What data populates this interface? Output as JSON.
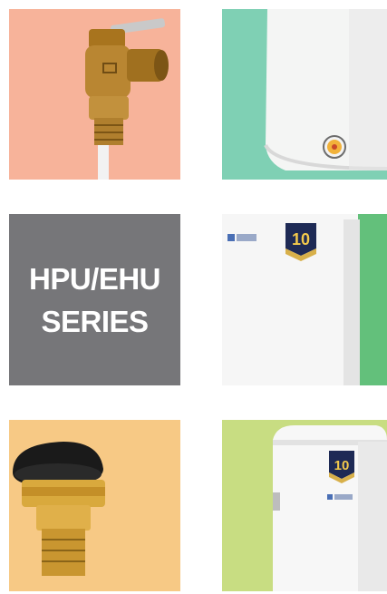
{
  "tiles": [
    {
      "name": "pressure-relief-valve",
      "color": "#f7b39a"
    },
    {
      "name": "water-heater-round",
      "color": "#7fd0b4"
    },
    {
      "name": "series-title",
      "color": "#767679",
      "lines": [
        "HPU/EHU",
        "SERIES"
      ]
    },
    {
      "name": "water-heater-square",
      "color": "#63c07b",
      "badge": "10"
    },
    {
      "name": "vacuum-relief-valve",
      "color": "#f7c985"
    },
    {
      "name": "water-heater-slim",
      "color": "#c8dd82",
      "badge": "10"
    }
  ]
}
